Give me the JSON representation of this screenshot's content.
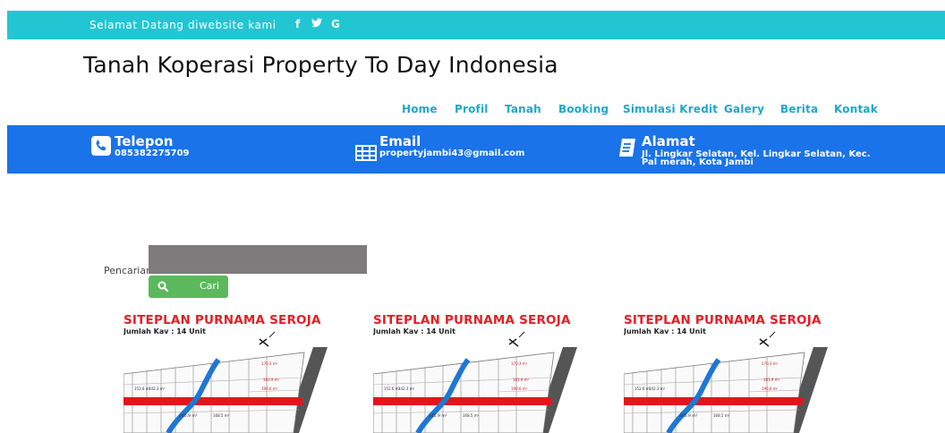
{
  "topbar": {
    "welcome_text": "Selamat Datang diwebsite kami",
    "social": [
      {
        "name": "facebook-icon",
        "glyph": "f"
      },
      {
        "name": "twitter-icon",
        "glyph": "🐦"
      },
      {
        "name": "google-icon",
        "glyph": "G"
      }
    ]
  },
  "header": {
    "title": "Tanah Koperasi Property To Day Indonesia"
  },
  "nav": {
    "items": [
      "Home",
      "Profil",
      "Tanah",
      "Booking",
      "Simulasi Kredit",
      "Galery",
      "Berita",
      "Kontak"
    ]
  },
  "contact": {
    "phone": {
      "icon": "phone-icon",
      "title": "Telepon",
      "value": "085382275709"
    },
    "email": {
      "icon": "email-icon",
      "title": "Email",
      "value": "propertyjambi43@gmail.com"
    },
    "address": {
      "icon": "address-book-icon",
      "title": "Alamat",
      "line1": "Jl. Lingkar Selatan, Kel. Lingkar Selatan, Kec.",
      "line2": "Pal merah, Kota Jambi"
    }
  },
  "search": {
    "label": "Pencarian:",
    "value": "",
    "button_label": "Cari",
    "button_icon": "search-icon"
  },
  "listings": [
    {
      "title": "SITEPLAN PURNAMA SEROJA",
      "subtitle": "Jumlah Kav : 14 Unit"
    },
    {
      "title": "SITEPLAN PURNAMA SEROJA",
      "subtitle": "Jumlah Kav : 14 Unit"
    },
    {
      "title": "SITEPLAN PURNAMA SEROJA",
      "subtitle": "Jumlah Kav : 14 Unit"
    }
  ],
  "colors": {
    "topbar": "#22c6d3",
    "infobar": "#1a73e8",
    "nav_link": "#1fa7c9",
    "search_button": "#5cb85c",
    "siteplan_title": "#e41e26"
  }
}
